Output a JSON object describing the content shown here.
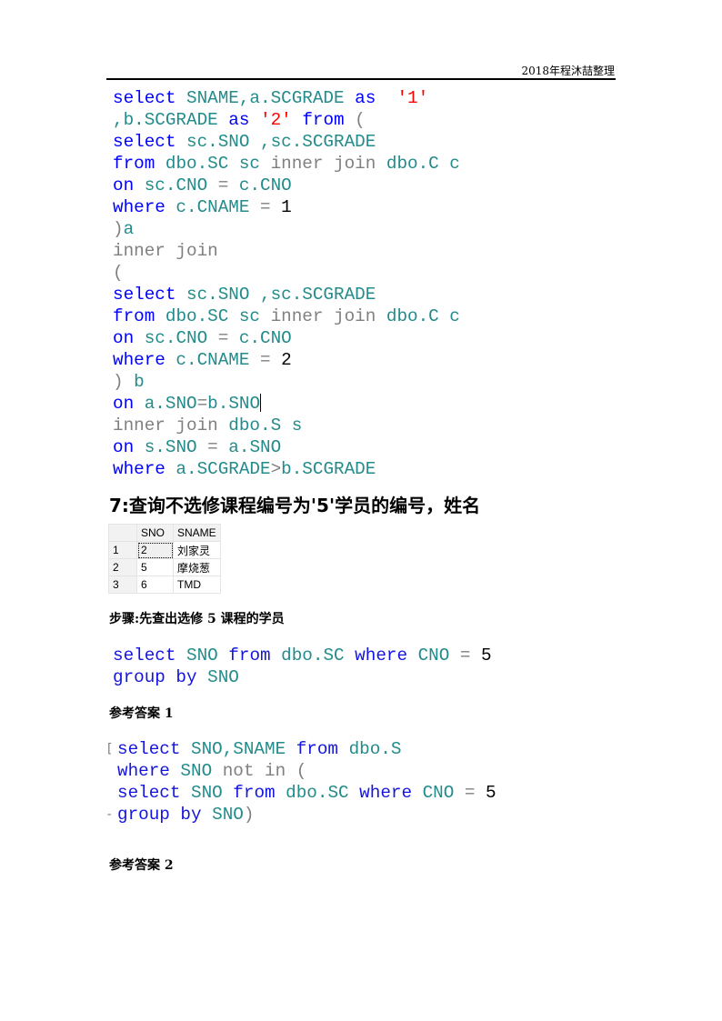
{
  "header": {
    "text": "2018年程沐喆整理"
  },
  "code_block_1": {
    "lines": [
      [
        {
          "t": "select",
          "c": "kw"
        },
        {
          "t": " SNAME,a.SCGRADE ",
          "c": "id"
        },
        {
          "t": "as",
          "c": "kw"
        },
        {
          "t": "  ",
          "c": "id"
        },
        {
          "t": "'1'",
          "c": "str"
        }
      ],
      [
        {
          "t": ",b.SCGRADE ",
          "c": "id"
        },
        {
          "t": "as",
          "c": "kw"
        },
        {
          "t": " ",
          "c": "id"
        },
        {
          "t": "'2'",
          "c": "str"
        },
        {
          "t": " ",
          "c": "id"
        },
        {
          "t": "from",
          "c": "kw"
        },
        {
          "t": " (",
          "c": "gray"
        }
      ],
      [
        {
          "t": "select",
          "c": "kw"
        },
        {
          "t": " sc.SNO ,sc.SCGRADE",
          "c": "id"
        }
      ],
      [
        {
          "t": "from",
          "c": "kw"
        },
        {
          "t": " dbo.SC sc ",
          "c": "id"
        },
        {
          "t": "inner join",
          "c": "gray"
        },
        {
          "t": " dbo.C c",
          "c": "id"
        }
      ],
      [
        {
          "t": "on",
          "c": "kw"
        },
        {
          "t": " sc.CNO ",
          "c": "id"
        },
        {
          "t": "=",
          "c": "gray"
        },
        {
          "t": " c.CNO",
          "c": "id"
        }
      ],
      [
        {
          "t": "where",
          "c": "kw"
        },
        {
          "t": " c.CNAME ",
          "c": "id"
        },
        {
          "t": "=",
          "c": "gray"
        },
        {
          "t": " ",
          "c": "id"
        },
        {
          "t": "1",
          "c": "num"
        }
      ],
      [
        {
          "t": ")",
          "c": "gray"
        },
        {
          "t": "a",
          "c": "id"
        }
      ],
      [
        {
          "t": "inner join",
          "c": "gray"
        }
      ],
      [
        {
          "t": "(",
          "c": "gray"
        }
      ],
      [
        {
          "t": "select",
          "c": "kw"
        },
        {
          "t": " sc.SNO ,sc.SCGRADE",
          "c": "id"
        }
      ],
      [
        {
          "t": "from",
          "c": "kw"
        },
        {
          "t": " dbo.SC sc ",
          "c": "id"
        },
        {
          "t": "inner join",
          "c": "gray"
        },
        {
          "t": " dbo.C c",
          "c": "id"
        }
      ],
      [
        {
          "t": "on",
          "c": "kw"
        },
        {
          "t": " sc.CNO ",
          "c": "id"
        },
        {
          "t": "=",
          "c": "gray"
        },
        {
          "t": " c.CNO",
          "c": "id"
        }
      ],
      [
        {
          "t": "where",
          "c": "kw"
        },
        {
          "t": " c.CNAME ",
          "c": "id"
        },
        {
          "t": "=",
          "c": "gray"
        },
        {
          "t": " ",
          "c": "id"
        },
        {
          "t": "2",
          "c": "num"
        }
      ],
      [
        {
          "t": ")",
          "c": "gray"
        },
        {
          "t": " b",
          "c": "id"
        }
      ],
      [
        {
          "t": "on",
          "c": "kw"
        },
        {
          "t": " a.SNO",
          "c": "id"
        },
        {
          "t": "=",
          "c": "gray"
        },
        {
          "t": "b.SNO",
          "c": "id"
        },
        {
          "t": "",
          "c": "caret"
        }
      ],
      [
        {
          "t": "inner join",
          "c": "gray"
        },
        {
          "t": " dbo.S s",
          "c": "id"
        }
      ],
      [
        {
          "t": "on",
          "c": "kw"
        },
        {
          "t": " s.SNO ",
          "c": "id"
        },
        {
          "t": "=",
          "c": "gray"
        },
        {
          "t": " a.SNO",
          "c": "id"
        }
      ],
      [
        {
          "t": "where",
          "c": "kw"
        },
        {
          "t": " a.SCGRADE",
          "c": "id"
        },
        {
          "t": ">",
          "c": "gray"
        },
        {
          "t": "b.SCGRADE",
          "c": "id"
        }
      ]
    ]
  },
  "section7": {
    "title": "7:查询不选修课程编号为'5'学员的编号，姓名"
  },
  "result_grid": {
    "columns": [
      "",
      "SNO",
      "SNAME"
    ],
    "rows": [
      [
        "1",
        "2",
        "刘家灵"
      ],
      [
        "2",
        "5",
        "摩烧葱"
      ],
      [
        "3",
        "6",
        "TMD"
      ]
    ]
  },
  "step_label": "步骤:先查出选修 5 课程的学员",
  "code_block_2": {
    "lines": [
      [
        {
          "t": "select",
          "c": "kw"
        },
        {
          "t": " SNO ",
          "c": "id"
        },
        {
          "t": "from",
          "c": "kw"
        },
        {
          "t": " dbo.SC ",
          "c": "id"
        },
        {
          "t": "where",
          "c": "kw"
        },
        {
          "t": " CNO ",
          "c": "id"
        },
        {
          "t": "=",
          "c": "gray"
        },
        {
          "t": " ",
          "c": "id"
        },
        {
          "t": "5",
          "c": "num"
        }
      ],
      [
        {
          "t": "group by",
          "c": "kw"
        },
        {
          "t": " SNO",
          "c": "id"
        }
      ]
    ]
  },
  "answer1_label": "参考答案 1",
  "code_block_3": {
    "lines": [
      [
        {
          "t": "select",
          "c": "kw"
        },
        {
          "t": " SNO,SNAME ",
          "c": "id"
        },
        {
          "t": "from",
          "c": "kw"
        },
        {
          "t": " dbo.S",
          "c": "id"
        }
      ],
      [
        {
          "t": "where",
          "c": "kw"
        },
        {
          "t": " SNO ",
          "c": "id"
        },
        {
          "t": "not in",
          "c": "gray"
        },
        {
          "t": " (",
          "c": "gray"
        }
      ],
      [
        {
          "t": "select",
          "c": "kw"
        },
        {
          "t": " SNO ",
          "c": "id"
        },
        {
          "t": "from",
          "c": "kw"
        },
        {
          "t": " dbo.SC ",
          "c": "id"
        },
        {
          "t": "where",
          "c": "kw"
        },
        {
          "t": " CNO ",
          "c": "id"
        },
        {
          "t": "=",
          "c": "gray"
        },
        {
          "t": " ",
          "c": "id"
        },
        {
          "t": "5",
          "c": "num"
        }
      ],
      [
        {
          "t": "group by",
          "c": "kw"
        },
        {
          "t": " SNO",
          "c": "id"
        },
        {
          "t": ")",
          "c": "gray"
        }
      ]
    ]
  },
  "answer2_label": "参考答案 2",
  "colors": {
    "keyword": "#0000ff",
    "identifier": "#238b8b",
    "operator": "#808080",
    "string": "#ff0000",
    "number": "#000000"
  }
}
